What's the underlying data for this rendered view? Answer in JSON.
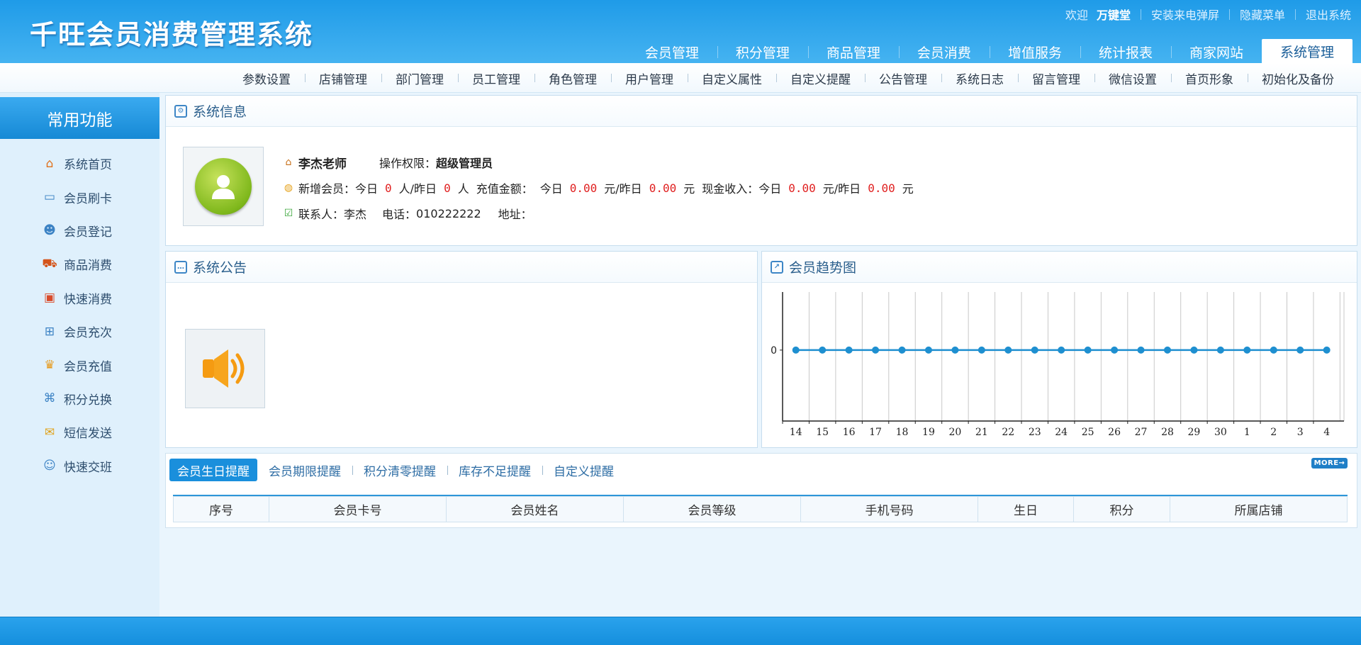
{
  "header": {
    "logo": "千旺会员消费管理系统",
    "welcome": "欢迎",
    "user": "万键堂",
    "links": [
      "安装来电弹屏",
      "隐藏菜单",
      "退出系统"
    ]
  },
  "main_nav": [
    "会员管理",
    "积分管理",
    "商品管理",
    "会员消费",
    "增值服务",
    "统计报表",
    "商家网站",
    "系统管理"
  ],
  "main_nav_active": "系统管理",
  "sub_nav": [
    "参数设置",
    "店铺管理",
    "部门管理",
    "员工管理",
    "角色管理",
    "用户管理",
    "自定义属性",
    "自定义提醒",
    "公告管理",
    "系统日志",
    "留言管理",
    "微信设置",
    "首页形象",
    "初始化及备份"
  ],
  "sidebar": {
    "title": "常用功能",
    "items": [
      {
        "label": "系统首页",
        "icon": "home-icon"
      },
      {
        "label": "会员刷卡",
        "icon": "member-card-icon"
      },
      {
        "label": "会员登记",
        "icon": "users-icon"
      },
      {
        "label": "商品消费",
        "icon": "cart-icon"
      },
      {
        "label": "快速消费",
        "icon": "chart-icon"
      },
      {
        "label": "会员充次",
        "icon": "basket-icon"
      },
      {
        "label": "会员充值",
        "icon": "crown-icon"
      },
      {
        "label": "积分兑换",
        "icon": "gift-icon"
      },
      {
        "label": "短信发送",
        "icon": "mail-icon"
      },
      {
        "label": "快速交班",
        "icon": "user-switch-icon"
      }
    ]
  },
  "system_info": {
    "title": "系统信息",
    "name": "李杰老师",
    "permission_label": "操作权限：",
    "permission": "超级管理员",
    "new_members_label": "新增会员：今日",
    "today_members": "0",
    "mid1": "人/昨日",
    "yesterday_members": "0",
    "unit_person": "人",
    "recharge_label": "充值金额：",
    "today_label": "今日",
    "today_recharge": "0.00",
    "mid2": "元/昨日",
    "yesterday_recharge": "0.00",
    "unit_yuan": "元",
    "cash_label": "现金收入：今日",
    "today_cash": "0.00",
    "mid3": "元/昨日",
    "yesterday_cash": "0.00",
    "unit_yuan2": "元",
    "contact_label": "联系人：",
    "contact": "李杰",
    "phone_label": "电话：",
    "phone": "010222222",
    "address_label": "地址："
  },
  "notice": {
    "title": "系统公告"
  },
  "trend": {
    "title": "会员趋势图"
  },
  "chart_data": {
    "type": "line",
    "x": [
      "14",
      "15",
      "16",
      "17",
      "18",
      "19",
      "20",
      "21",
      "22",
      "23",
      "24",
      "25",
      "26",
      "27",
      "28",
      "29",
      "30",
      "1",
      "2",
      "3",
      "4"
    ],
    "series": [
      {
        "values": [
          0,
          0,
          0,
          0,
          0,
          0,
          0,
          0,
          0,
          0,
          0,
          0,
          0,
          0,
          0,
          0,
          0,
          0,
          0,
          0,
          0
        ]
      }
    ],
    "y_ticks": [
      "0"
    ],
    "grid": "vertical",
    "color": "#1e8fd0"
  },
  "reminder_tabs": [
    "会员生日提醒",
    "会员期限提醒",
    "积分清零提醒",
    "库存不足提醒",
    "自定义提醒"
  ],
  "more_label": "MORE→",
  "table_headers": [
    "序号",
    "会员卡号",
    "会员姓名",
    "会员等级",
    "手机号码",
    "生日",
    "积分",
    "所属店铺"
  ]
}
